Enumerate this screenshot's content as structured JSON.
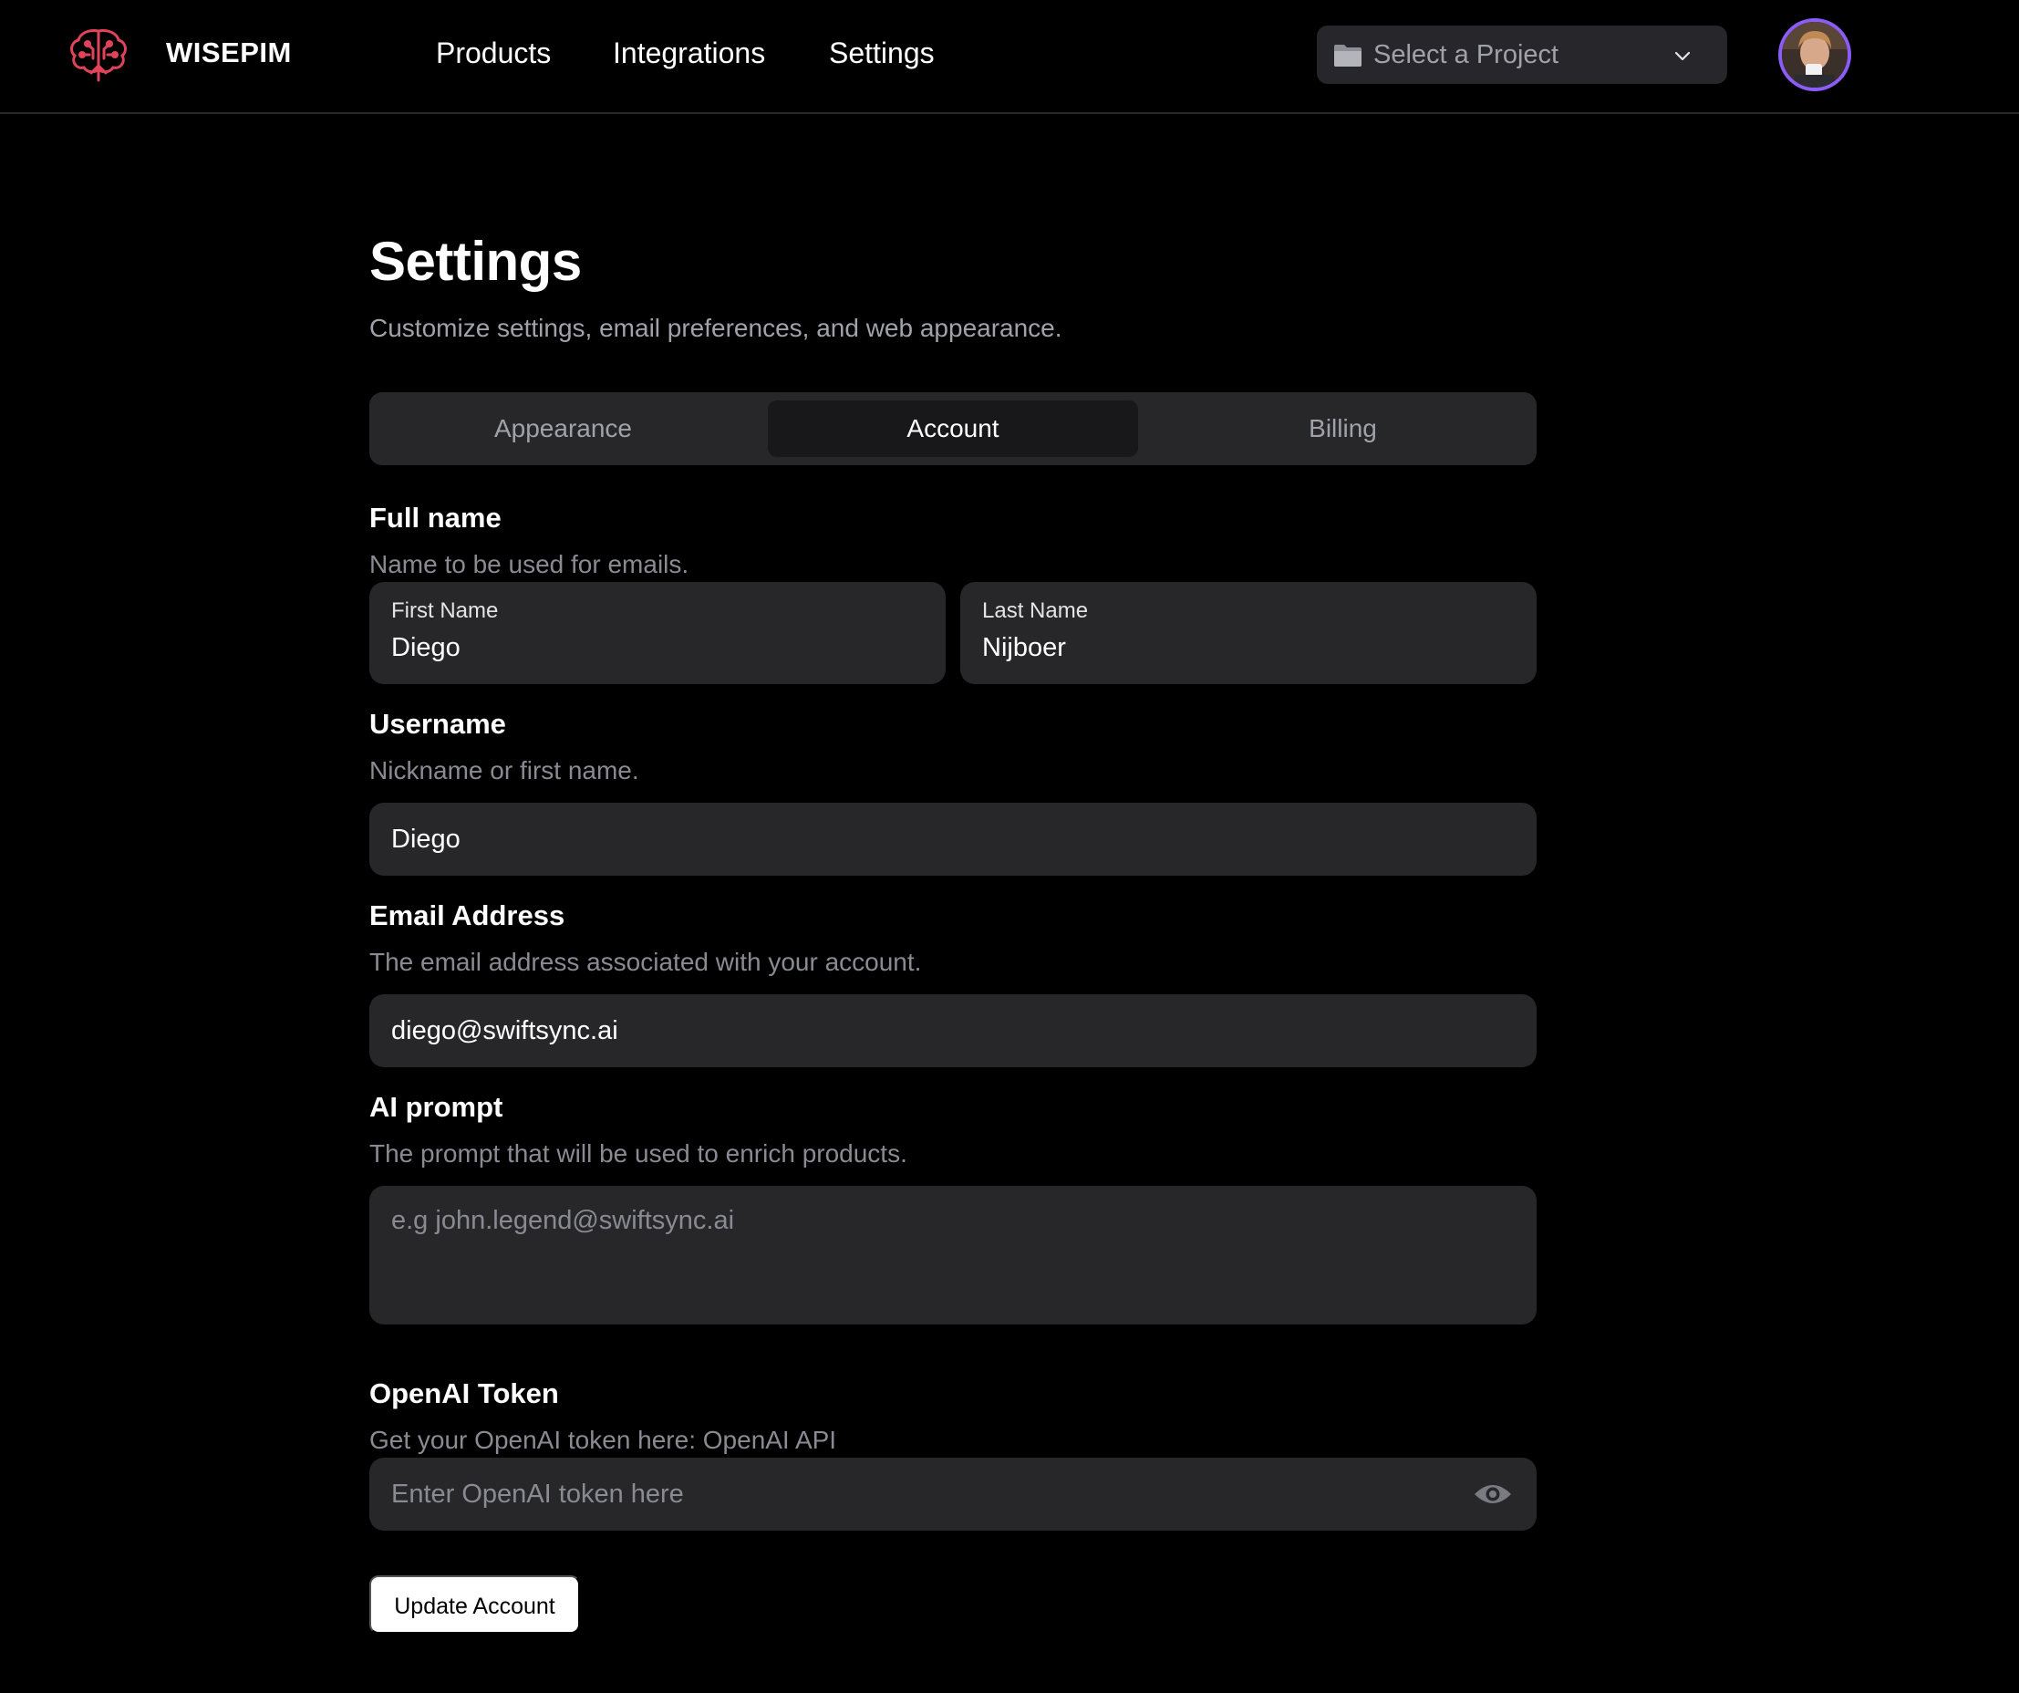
{
  "header": {
    "brand": "WISEPIM",
    "logo_icon": "brain-tree-icon",
    "nav": [
      {
        "label": "Products"
      },
      {
        "label": "Integrations"
      },
      {
        "label": "Settings"
      }
    ],
    "project_select": {
      "icon": "folder-icon",
      "label": "Select a Project"
    },
    "avatar_icon": "user-avatar"
  },
  "page": {
    "title": "Settings",
    "subtitle": "Customize settings, email preferences, and web appearance."
  },
  "tabs": [
    {
      "label": "Appearance",
      "active": false
    },
    {
      "label": "Account",
      "active": true
    },
    {
      "label": "Billing",
      "active": false
    }
  ],
  "form": {
    "full_name": {
      "label": "Full name",
      "description": "Name to be used for emails.",
      "first_name_label": "First Name",
      "first_name_value": "Diego",
      "last_name_label": "Last Name",
      "last_name_value": "Nijboer"
    },
    "username": {
      "label": "Username",
      "description": "Nickname or first name.",
      "value": "Diego"
    },
    "email": {
      "label": "Email Address",
      "description": "The email address associated with your account.",
      "value": "diego@swiftsync.ai"
    },
    "ai_prompt": {
      "label": "AI prompt",
      "description": "The prompt that will be used to enrich products.",
      "placeholder": "e.g john.legend@swiftsync.ai"
    },
    "openai_token": {
      "label": "OpenAI Token",
      "description": "Get your OpenAI token here: OpenAI API",
      "placeholder": "Enter OpenAI token here",
      "toggle_icon": "eye-icon"
    },
    "submit_label": "Update Account"
  },
  "colors": {
    "background": "#000000",
    "surface": "#27272a",
    "active_tab": "#18181b",
    "muted_text": "#8a8a93",
    "logo_accent": "#e0435a",
    "avatar_ring": "#8b5cf6"
  }
}
